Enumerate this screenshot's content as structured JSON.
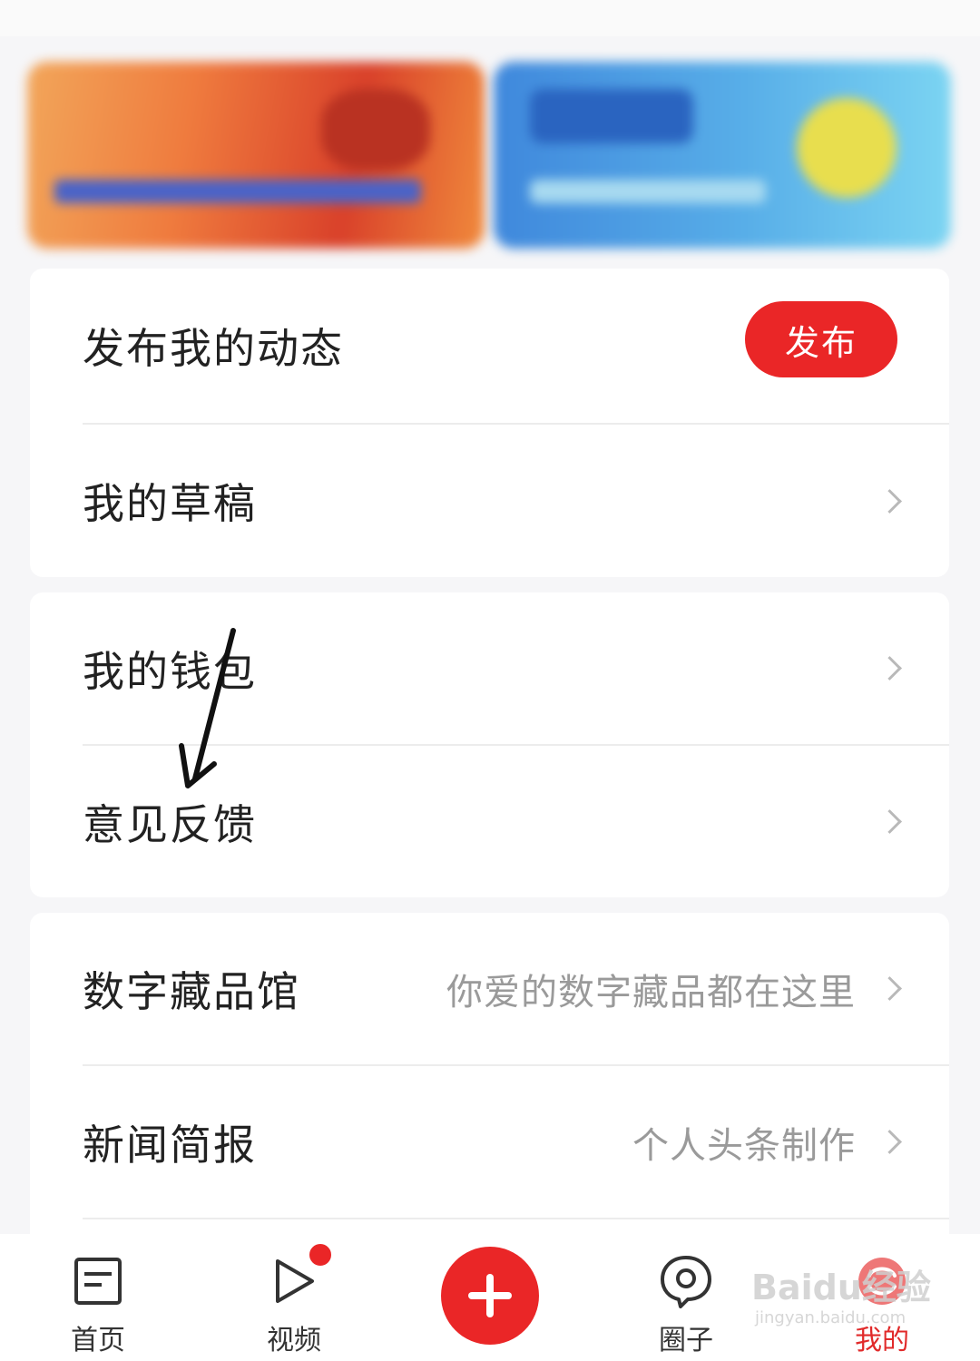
{
  "menu": {
    "card1": {
      "publish_label": "发布我的动态",
      "publish_button": "发布",
      "drafts_label": "我的草稿"
    },
    "card2": {
      "wallet_label": "我的钱包",
      "feedback_label": "意见反馈"
    },
    "card3": {
      "collection_label": "数字藏品馆",
      "collection_sub": "你爱的数字藏品都在这里",
      "brief_label": "新闻简报",
      "brief_sub": "个人头条制作"
    }
  },
  "bottom_nav": {
    "items": [
      {
        "label": "首页",
        "icon": "news-icon"
      },
      {
        "label": "视频",
        "icon": "play-icon"
      },
      {
        "label": "",
        "icon": "plus-icon"
      },
      {
        "label": "圈子",
        "icon": "circle-location-icon"
      },
      {
        "label": "我的",
        "icon": "profile-icon"
      }
    ]
  },
  "watermark": {
    "main": "Baidu经验",
    "sub": "jingyan.baidu.com"
  },
  "colors": {
    "accent": "#ea2627",
    "active_tab": "#e12a2a"
  }
}
